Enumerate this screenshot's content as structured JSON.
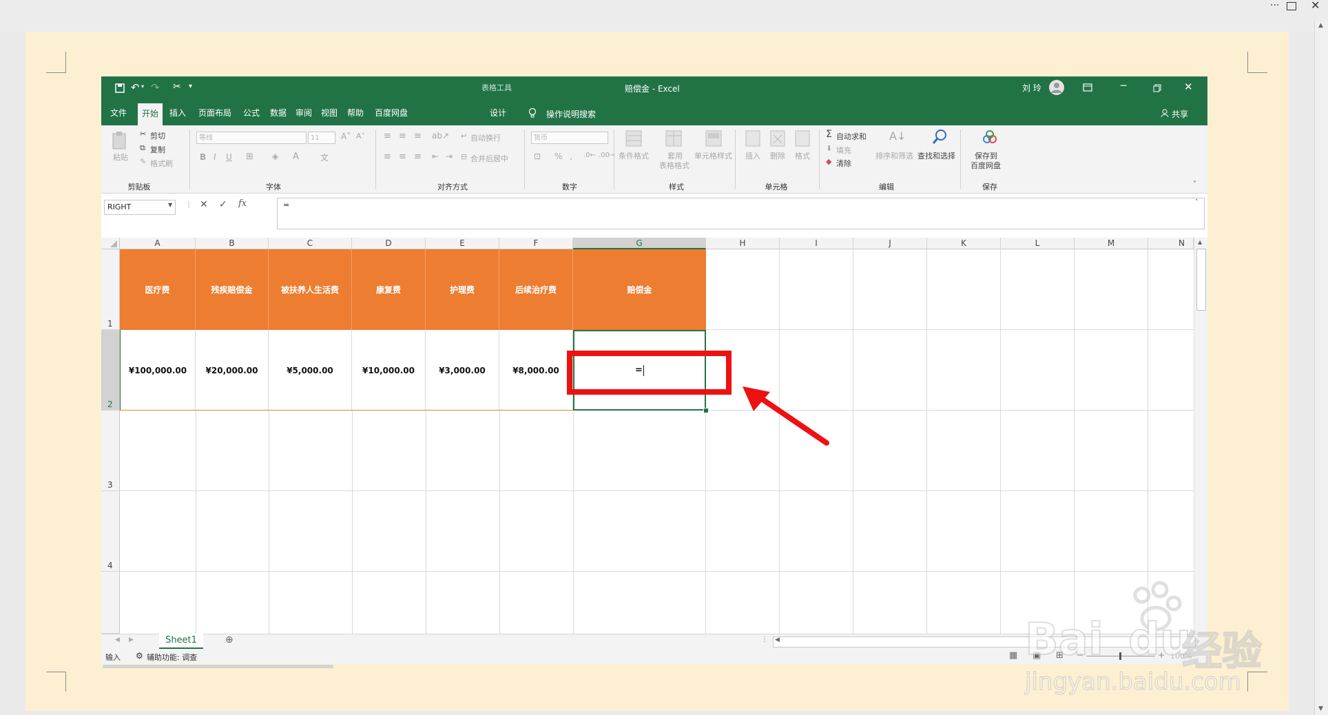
{
  "viewer": {
    "more_icon": "ellipsis-icon",
    "pin_icon": "pin-icon",
    "close_icon": "close-icon"
  },
  "title_bar": {
    "context_tab_group": "表格工具",
    "document_title": "赔偿金  -  Excel",
    "user_name": "刘 玲"
  },
  "tabs": [
    {
      "label": "文件"
    },
    {
      "label": "开始"
    },
    {
      "label": "插入"
    },
    {
      "label": "页面布局"
    },
    {
      "label": "公式"
    },
    {
      "label": "数据"
    },
    {
      "label": "审阅"
    },
    {
      "label": "视图"
    },
    {
      "label": "帮助"
    },
    {
      "label": "百度网盘"
    },
    {
      "label": "设计"
    }
  ],
  "tell_me": "操作说明搜索",
  "share": "共享",
  "ribbon": {
    "clipboard": {
      "paste": "粘贴",
      "cut": "剪切",
      "copy": "复制",
      "format_painter": "格式刷",
      "label": "剪贴板"
    },
    "font": {
      "font_name": "等线",
      "font_size": "11",
      "label": "字体"
    },
    "alignment": {
      "wrap_text": "自动换行",
      "merge_center": "合并后居中",
      "label": "对齐方式"
    },
    "number": {
      "format": "货币",
      "label": "数字"
    },
    "styles": {
      "conditional": "条件格式",
      "table_format_1": "套用",
      "table_format_2": "表格格式",
      "cell_styles": "单元格样式",
      "label": "样式"
    },
    "cells": {
      "insert": "插入",
      "delete": "删除",
      "format": "格式",
      "label": "单元格"
    },
    "editing": {
      "autosum": "自动求和",
      "fill": "填充",
      "clear": "清除",
      "sort_filter": "排序和筛选",
      "find_select": "查找和选择",
      "label": "编辑"
    },
    "save": {
      "line1": "保存到",
      "line2": "百度网盘",
      "label": "保存"
    }
  },
  "formula_bar": {
    "name_box": "RIGHT",
    "fx": "fx",
    "content": "="
  },
  "columns": [
    "A",
    "B",
    "C",
    "D",
    "E",
    "F",
    "G",
    "H",
    "I",
    "J",
    "K",
    "L",
    "M",
    "N"
  ],
  "rows": [
    "1",
    "2",
    "3",
    "4"
  ],
  "table_headers": [
    "医疗费",
    "残疾赔偿金",
    "被扶养人生活费",
    "康复费",
    "护理费",
    "后续治疗费",
    "赔偿金"
  ],
  "table_values": [
    "¥100,000.00",
    "¥20,000.00",
    "¥5,000.00",
    "¥10,000.00",
    "¥3,000.00",
    "¥8,000.00",
    "="
  ],
  "sheet_tab": "Sheet1",
  "status": {
    "mode": "输入",
    "accessibility": "辅助功能: 调查",
    "zoom": "100%"
  },
  "watermark": {
    "line1": "Bai",
    "line2": "du",
    "brand_cn": "经验",
    "url": "jingyan.baidu.com"
  },
  "colors": {
    "excel_green": "#217346",
    "header_orange": "#ed7d31",
    "annotation_red": "#ee1111"
  }
}
